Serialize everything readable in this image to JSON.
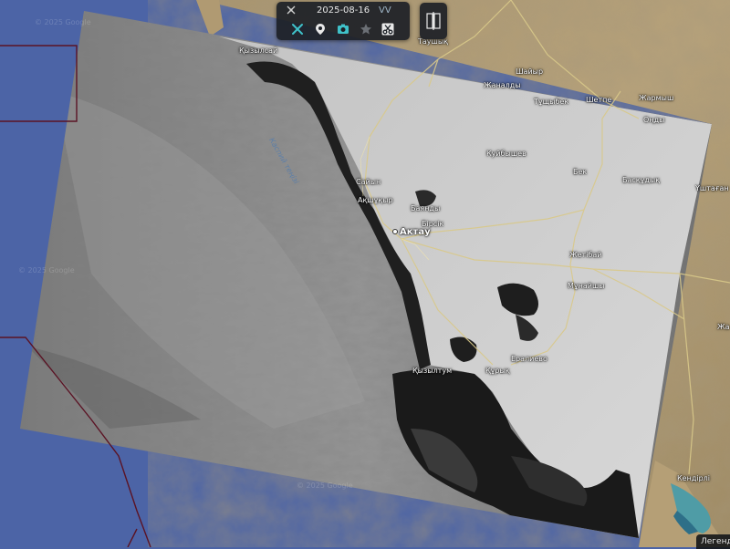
{
  "toolbar": {
    "date": "2025-08-16",
    "polarization": "VV",
    "icons": [
      "satellite-icon",
      "tools-icon",
      "location-pin-icon",
      "camera-icon",
      "star-icon",
      "scissors-icon"
    ],
    "accent_color": "#3fc1c9"
  },
  "compare_button": {
    "icon": "compare-split-icon"
  },
  "legend": {
    "label": "Легенда"
  },
  "map": {
    "sea_label": "Каспий теңізі",
    "cities": {
      "aktau": "Актау",
      "kyzylsai": "Қызылсай",
      "sayyn": "Сайын",
      "akshukyr": "Ақшұқыр",
      "baskuduk": "Баянды",
      "basqudyq_big": "Басқұдық",
      "bersik": "Бірсік",
      "kuryk": "Құрық",
      "kyzyltum": "Қызылтум",
      "eraliev": "Ералиево",
      "zhetybay": "Жетібай",
      "munaishy": "Мұнайшы",
      "kuybyshev": "Куйбышев",
      "bek": "Бек",
      "tauchik": "Таушық",
      "shaiyr": "Шайыр",
      "zhanaldy": "Жаналды",
      "tushybek": "Тұщыбек",
      "shetpe": "Шетпе",
      "zharmysh": "Жармыш",
      "ondy": "Оңды",
      "ushtagan": "Үштаған",
      "kendirli": "Кендірлі",
      "zhanaozen_dir": "Жа"
    },
    "credits": [
      "© 2025 Google",
      "© 2025 Google",
      "© 2025 Google"
    ]
  }
}
